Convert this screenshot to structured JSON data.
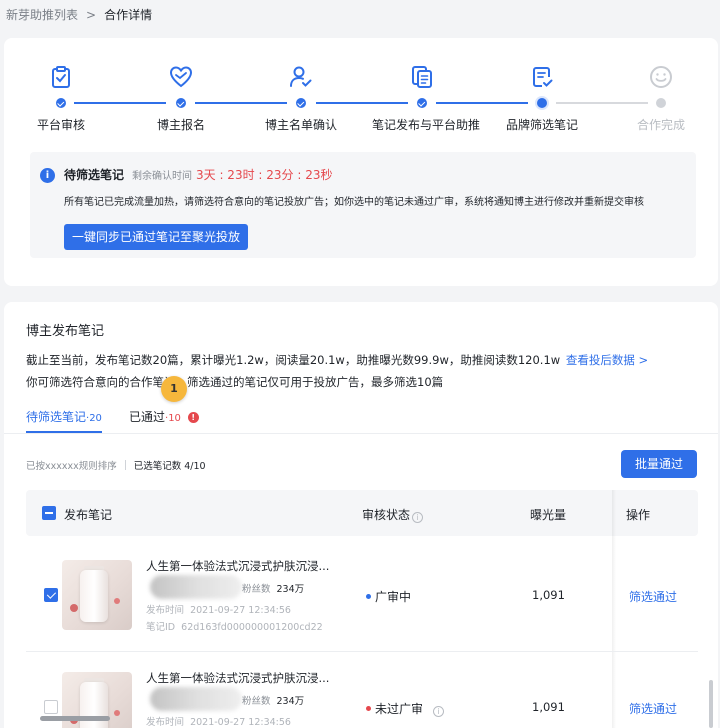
{
  "breadcrumb": {
    "parent": "新芽助推列表",
    "separator": ">",
    "current": "合作详情"
  },
  "steps": [
    {
      "label": "平台审核",
      "icon": "clipboard-check-icon",
      "state": "done"
    },
    {
      "label": "博主报名",
      "icon": "heart-handshake-icon",
      "state": "done"
    },
    {
      "label": "博主名单确认",
      "icon": "user-check-icon",
      "state": "done"
    },
    {
      "label": "笔记发布与平台助推",
      "icon": "document-copy-icon",
      "state": "done"
    },
    {
      "label": "品牌筛选笔记",
      "icon": "document-check-icon",
      "state": "current"
    },
    {
      "label": "合作完成",
      "icon": "smile-icon",
      "state": "pending"
    }
  ],
  "notice": {
    "icon": "info-icon",
    "title": "待筛选笔记",
    "remaining_label": "剩余确认时间",
    "countdown": "3天 : 23时 : 23分 : 23秒",
    "description": "所有笔记已完成流量加热，请筛选符合意向的笔记投放广告；如你选中的笔记未通过广审，系统将通知博主进行修改并重新提交审核",
    "sync_button": "一键同步已通过笔记至聚光投放"
  },
  "section": {
    "title": "博主发布笔记",
    "summary_line1": "截止至当前，发布笔记数20篇，累计曝光1.2w，阅读量20.1w，助推曝光数99.9w，助推阅读数120.1w",
    "summary_link": "查看投后数据 >",
    "summary_line2": "你可筛选符合意向的合作笔记，筛选通过的笔记仅可用于投放广告，最多筛选10篇",
    "step_badge": "1"
  },
  "tabs": [
    {
      "label": "待筛选笔记",
      "count": "·20"
    },
    {
      "label": "已通过",
      "count": "·10",
      "alert_icon": "!"
    }
  ],
  "toolbar": {
    "sort_text": "已按xxxxxx规则排序",
    "selected_text": "已选笔记数 4/10",
    "batch_button": "批量通过"
  },
  "table": {
    "headers": {
      "note": "发布笔记",
      "status": "审核状态",
      "status_help": "i",
      "views": "曝光量",
      "action": "操作"
    },
    "rows": [
      {
        "checked": true,
        "title": "人生第一体验法式沉浸式护肤沉浸...",
        "fans_label": "粉丝数",
        "fans_value": "234万",
        "publish_label": "发布时间",
        "publish_time": "2021-09-27 12:34:56",
        "note_id_label": "笔记ID",
        "note_id": "62d163fd000000001200cd22",
        "status": "广审中",
        "status_color": "#2f6fe8",
        "views": "1,091",
        "action": "筛选通过"
      },
      {
        "checked": false,
        "title": "人生第一体验法式沉浸式护肤沉浸...",
        "fans_label": "粉丝数",
        "fans_value": "234万",
        "publish_label": "发布时间",
        "publish_time": "2021-09-27 12:34:56",
        "status": "未过广审",
        "status_color": "#e5484d",
        "status_help": "i",
        "views": "1,091",
        "action": "筛选通过"
      }
    ]
  },
  "colors": {
    "accent": "#2f6fe8",
    "danger": "#e5484d",
    "pending": "#d0d3d8"
  }
}
